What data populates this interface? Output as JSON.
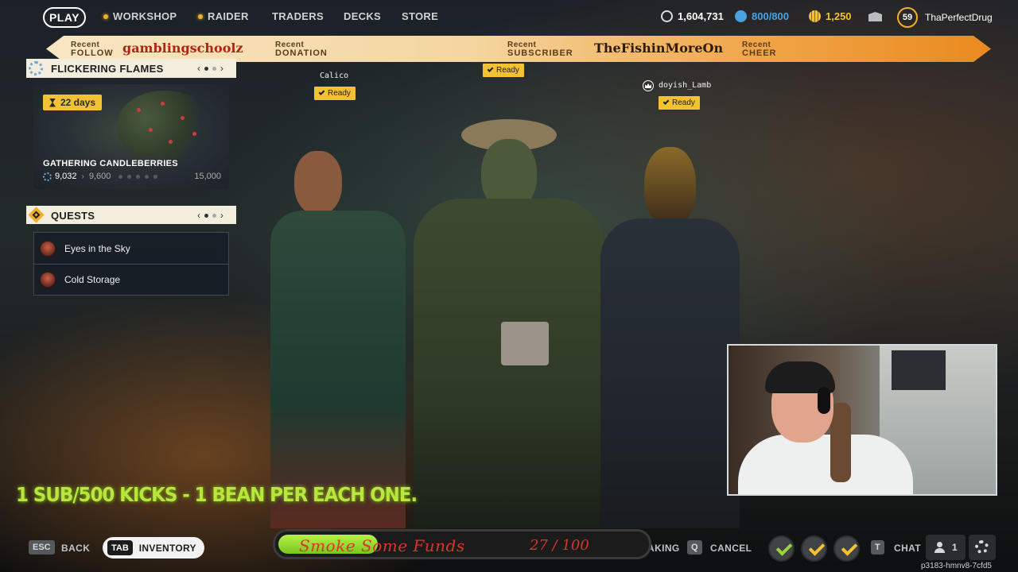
{
  "topnav": {
    "play": "PLAY",
    "items": [
      {
        "label": "WORKSHOP",
        "dot": true
      },
      {
        "label": "RAIDER",
        "dot": true
      },
      {
        "label": "TRADERS",
        "dot": false
      },
      {
        "label": "DECKS",
        "dot": false
      },
      {
        "label": "STORE",
        "dot": false
      }
    ],
    "currencies": [
      {
        "icon": "coin-icon",
        "value": "1,604,731",
        "color": "#d9dcde"
      },
      {
        "icon": "cred-icon",
        "value": "800/800",
        "color": "#4aa3e0"
      },
      {
        "icon": "token-icon",
        "value": "1,250",
        "color": "#f2c233"
      }
    ],
    "level": "59",
    "username": "ThaPerfectDrug"
  },
  "alerts": {
    "follow": {
      "label_top": "Recent",
      "label_bottom": "FOLLOW",
      "name": "gamblingschoolz"
    },
    "donation": {
      "label_top": "Recent",
      "label_bottom": "DONATION",
      "name": ""
    },
    "subscriber": {
      "label_top": "Recent",
      "label_bottom": "SUBSCRIBER",
      "name": "TheFishinMoreOn"
    },
    "cheer": {
      "label_top": "Recent",
      "label_bottom": "CHEER",
      "name": ""
    }
  },
  "event": {
    "title": "FLICKERING FLAMES",
    "days": "22 days",
    "name": "GATHERING CANDLEBERRIES",
    "current": "9,032",
    "next": "9,600",
    "max": "15,000"
  },
  "quests": {
    "title": "QUESTS",
    "items": [
      "Eyes in the Sky",
      "Cold Storage"
    ]
  },
  "squad": [
    {
      "name": "Calico",
      "status": "Ready"
    },
    {
      "name": "",
      "status": "Ready"
    },
    {
      "name": "doyish_Lamb",
      "status": "Ready"
    }
  ],
  "overlay": {
    "sub_goal": "1 SUB/500 KICKS - 1 BEAN PER EACH ONE.",
    "goal_label": "Smoke Some Funds",
    "goal_count": "27 / 100",
    "goal_progress": 0.27
  },
  "bottombar": {
    "esc_key": "ESC",
    "back": "BACK",
    "tab_key": "TAB",
    "inventory": "INVENTORY",
    "making": "AKING",
    "q_key": "Q",
    "cancel": "CANCEL",
    "t_key": "T",
    "chat": "CHAT",
    "friends_count": "1",
    "session": "p3183-hmnv8-7cfd5"
  },
  "colors": {
    "accent": "#f2c233",
    "goal_green": "#8fd62c",
    "alert_red": "#b1240f"
  }
}
